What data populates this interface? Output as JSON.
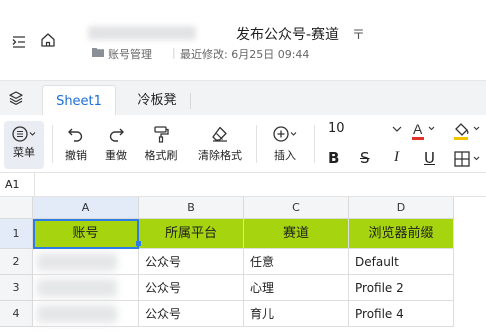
{
  "header": {
    "doc_title": "发布公众号-赛道",
    "folder": "账号管理",
    "modified": "最近修改: 6月25日 09:44",
    "pin_glyph": "〒"
  },
  "tabs": {
    "active": "Sheet1",
    "inactive": "冷板凳"
  },
  "toolbar": {
    "menu_label": "菜单",
    "undo_label": "撤销",
    "redo_label": "重做",
    "format_painter_label": "格式刷",
    "clear_format_label": "清除格式",
    "insert_label": "插入",
    "font_size": "10",
    "bold": "B",
    "strike": "S",
    "italic": "I",
    "underline": "U"
  },
  "formula_bar": {
    "cell_ref": "A1"
  },
  "grid": {
    "columns": [
      "A",
      "B",
      "C",
      "D"
    ],
    "rows": [
      "1",
      "2",
      "3",
      "4"
    ],
    "header_row": [
      "账号",
      "所属平台",
      "赛道",
      "浏览器前缀"
    ],
    "data": [
      [
        "",
        "公众号",
        "任意",
        "Default"
      ],
      [
        "",
        "公众号",
        "心理",
        "Profile 2"
      ],
      [
        "",
        "公众号",
        "育儿",
        "Profile 4"
      ]
    ],
    "header_fill": "#a6d40f",
    "selection_color": "#2e7be6"
  },
  "colors": {
    "accent": "#1e6fd9",
    "font_color_bar": "#e0312b",
    "fill_color_bar": "#f5c400"
  }
}
